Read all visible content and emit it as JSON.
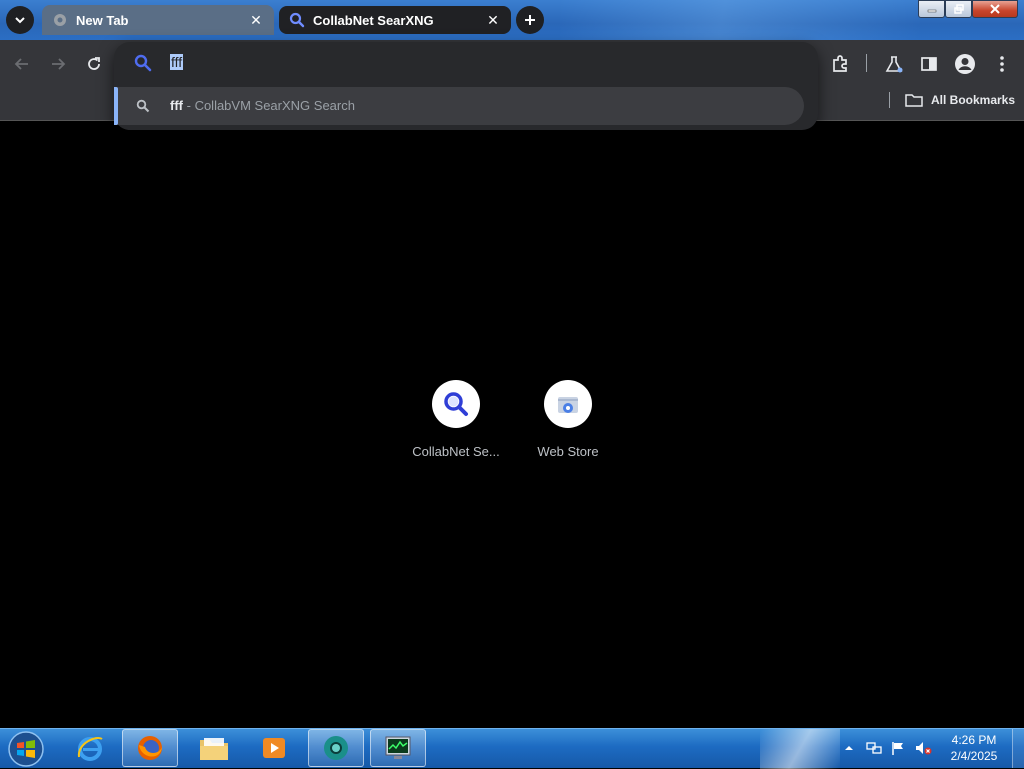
{
  "tabs": [
    {
      "title": "New Tab",
      "active": false
    },
    {
      "title": "CollabNet SearXNG",
      "active": true
    }
  ],
  "omnibox": {
    "typed_text": "fff",
    "suggestion": {
      "query": "fff",
      "separator": " - ",
      "source": "CollabVM SearXNG Search"
    }
  },
  "bookmarks_bar": {
    "all_bookmarks_label": "All Bookmarks"
  },
  "shortcuts": [
    {
      "label": "CollabNet Se...",
      "icon": "search-icon"
    },
    {
      "label": "Web Store",
      "icon": "web-store-icon"
    }
  ],
  "taskbar": {
    "clock_time": "4:26 PM",
    "clock_date": "2/4/2025",
    "apps": [
      "internet-explorer",
      "firefox",
      "file-explorer",
      "media-player",
      "chromium",
      "task-manager"
    ]
  },
  "colors": {
    "accent": "#8ab4f8",
    "search_icon_blue": "#2f3ed6",
    "toolbar_bg": "#35363a"
  }
}
